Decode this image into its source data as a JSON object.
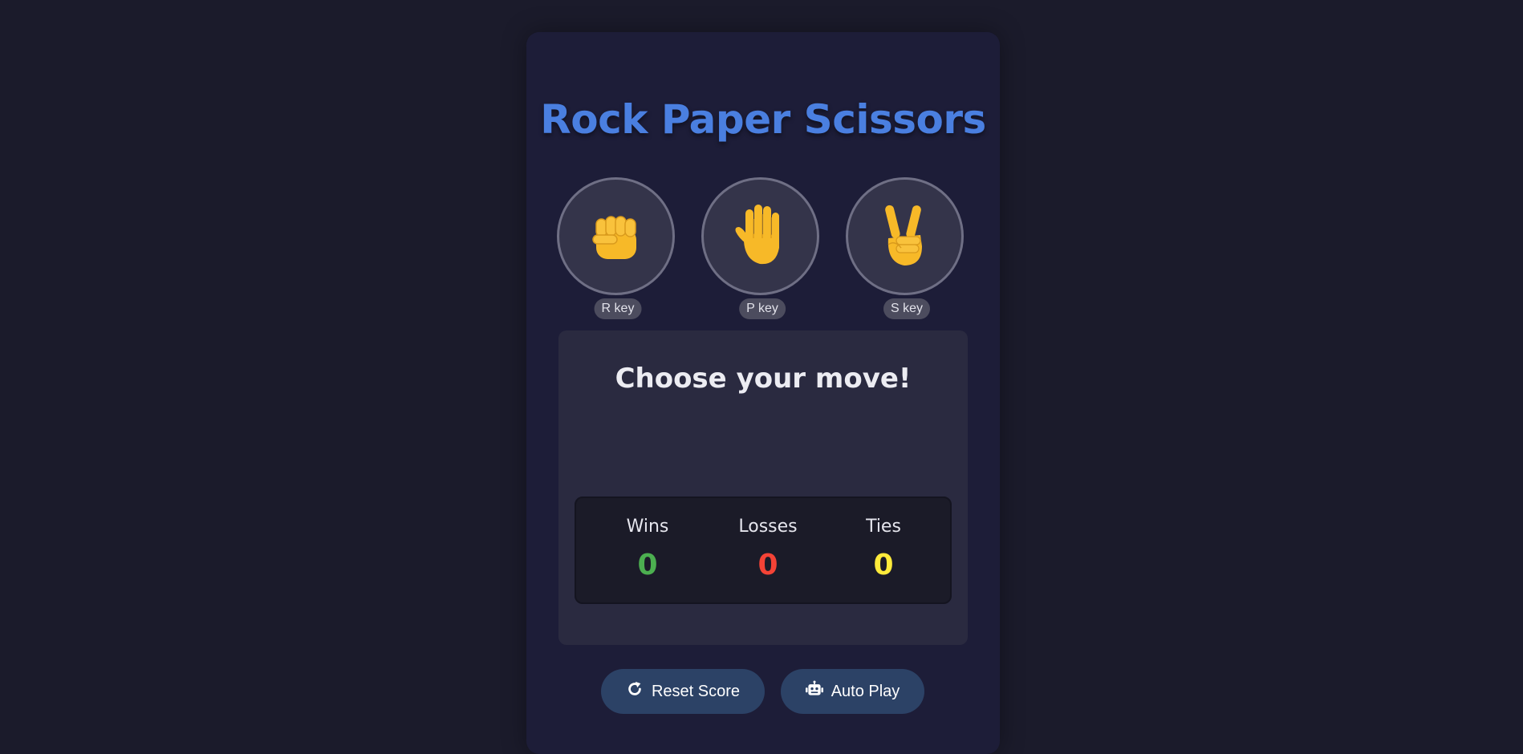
{
  "title": "Rock Paper Scissors",
  "moves": [
    {
      "name": "Rock",
      "icon": "raised-fist-icon",
      "key_label": "R key"
    },
    {
      "name": "Paper",
      "icon": "raised-hand-icon",
      "key_label": "P key"
    },
    {
      "name": "Scissors",
      "icon": "victory-hand-icon",
      "key_label": "S key"
    }
  ],
  "result": {
    "message": "Choose your move!"
  },
  "score": {
    "wins_label": "Wins",
    "wins": "0",
    "losses_label": "Losses",
    "losses": "0",
    "ties_label": "Ties",
    "ties": "0"
  },
  "buttons": {
    "reset": {
      "label": "Reset Score",
      "icon": "rotate-right-icon"
    },
    "autoplay": {
      "label": "Auto Play",
      "icon": "robot-icon"
    }
  },
  "colors": {
    "title": "#4a7fe0",
    "wins": "#4caf50",
    "losses": "#f44336",
    "ties": "#ffeb3b",
    "hand": "#f7b928"
  }
}
